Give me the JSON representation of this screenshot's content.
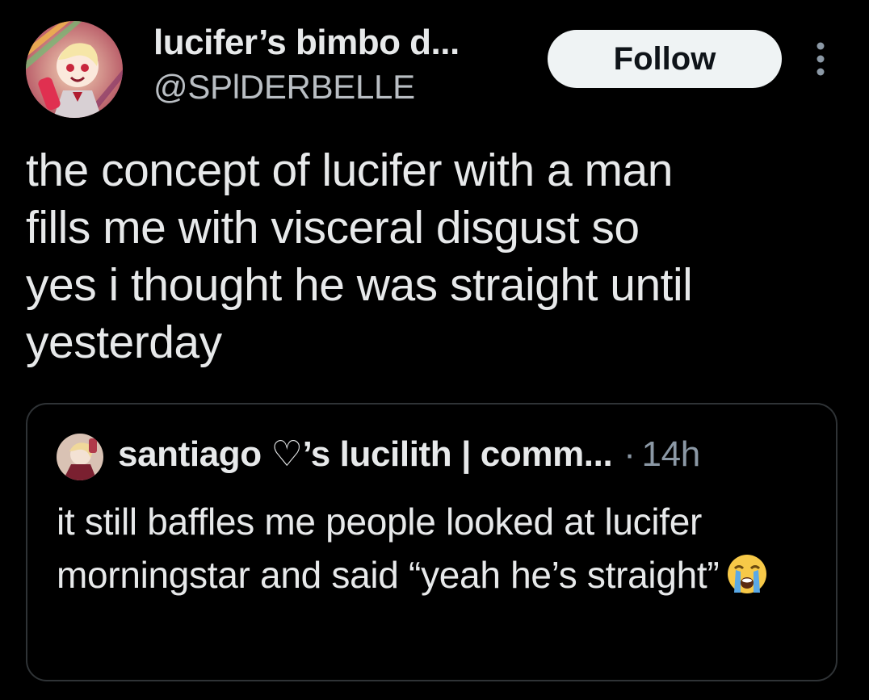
{
  "author": {
    "display_name": "lucifer’s bimbo d...",
    "handle": "@SPlDERBELLE",
    "avatar_icon": "profile-avatar-icon"
  },
  "follow_label": "Follow",
  "more_icon": "more-options-icon",
  "tweet_text": "the concept of lucifer with a man\nfills me with visceral disgust so\nyes i thought he was straight until\nyesterday",
  "quoted": {
    "name": "santiago ♡’s lucilith | comm...",
    "dot": "·",
    "time": "14h",
    "text": "it still baffles me people looked at lucifer morningstar and said “yeah he’s straight”",
    "emoji_icon": "loudly-crying-face-icon"
  },
  "colors": {
    "background": "#000000",
    "text": "#e7e9ea",
    "secondary_text": "#8b98a5",
    "border": "#2f3336",
    "button_bg": "#eff3f4"
  }
}
